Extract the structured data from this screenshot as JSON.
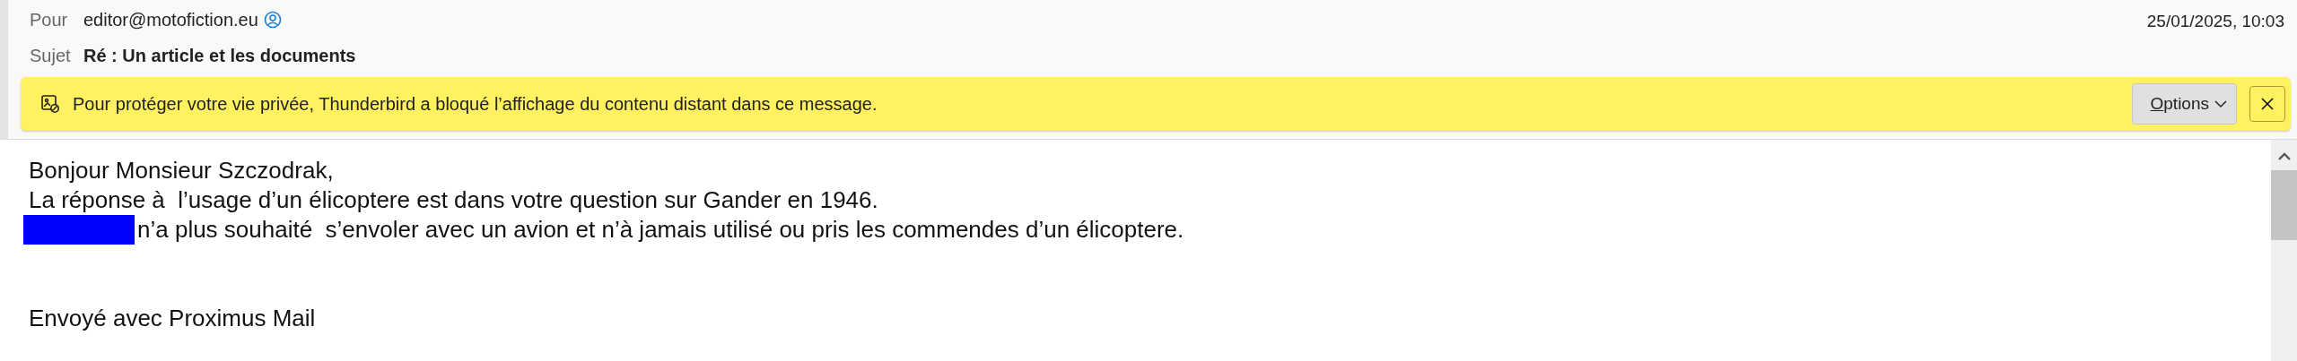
{
  "header": {
    "fields": [
      {
        "label": "Pour",
        "value": "editor@motofiction.eu",
        "kind": "contact"
      },
      {
        "label": "Sujet",
        "value": "Ré : Un article et les documents",
        "kind": "subject"
      }
    ],
    "date": "25/01/2025, 10:03"
  },
  "notification": {
    "message": "Pour protéger votre vie privée, Thunderbird a bloqué l’affichage du contenu distant dans ce message.",
    "options_button": "Options"
  },
  "body": {
    "lines": [
      {
        "kind": "text",
        "text": "Bonjour Monsieur Szczodrak,",
        "redacted": false
      },
      {
        "kind": "text",
        "text": "La réponse à  l’usage d’un élicoptere est dans votre question sur Gander en 1946.",
        "redacted": false
      },
      {
        "kind": "text",
        "text": "n’a plus souhaité  s’envoler avec un avion et n’à jamais utilisé ou pris les commendes d’un élicoptere.",
        "redacted": true
      },
      {
        "kind": "signature",
        "text": "Envoyé avec Proximus Mail",
        "redacted": false
      }
    ]
  }
}
